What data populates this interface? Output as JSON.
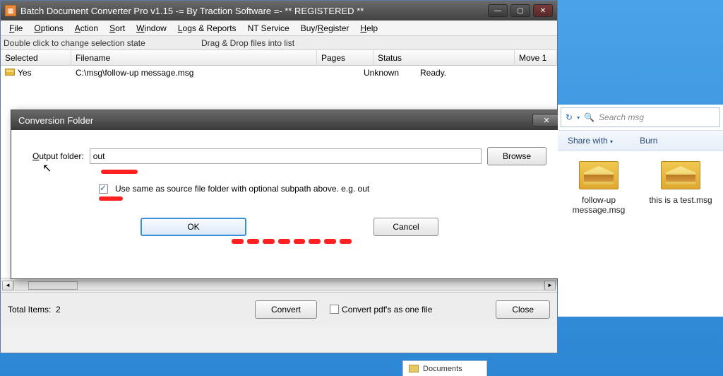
{
  "app": {
    "title": "Batch Document Converter Pro v1.15 -= By Traction Software =- ** REGISTERED **"
  },
  "menu": {
    "file": "File",
    "options": "Options",
    "action": "Action",
    "sort": "Sort",
    "window": "Window",
    "logs": "Logs & Reports",
    "nt": "NT Service",
    "buy": "Buy/Register",
    "help": "Help"
  },
  "hints": {
    "left": "Double click to change selection state",
    "right": "Drag & Drop files into list"
  },
  "columns": {
    "selected": "Selected",
    "filename": "Filename",
    "pages": "Pages",
    "status": "Status",
    "move": "Move 1"
  },
  "rows": [
    {
      "selected": "Yes",
      "filename": "C:\\msg\\follow-up message.msg",
      "pages": "Unknown",
      "status": "Ready."
    }
  ],
  "bottom": {
    "total_label": "Total Items:",
    "total_count": "2",
    "convert": "Convert",
    "convert_one": "Convert pdf's as one file",
    "close": "Close"
  },
  "modal": {
    "title": "Conversion Folder",
    "output_label": "Output folder:",
    "output_value": "out",
    "browse": "Browse",
    "same_source": "Use same as source file folder with optional subpath above. e.g. out",
    "ok": "OK",
    "cancel": "Cancel"
  },
  "explorer": {
    "search_placeholder": "Search msg",
    "share": "Share with",
    "burn": "Burn",
    "files": [
      {
        "name": "follow-up message.msg"
      },
      {
        "name": "this is a test.msg"
      }
    ]
  },
  "taskbar": {
    "docs": "Documents"
  }
}
